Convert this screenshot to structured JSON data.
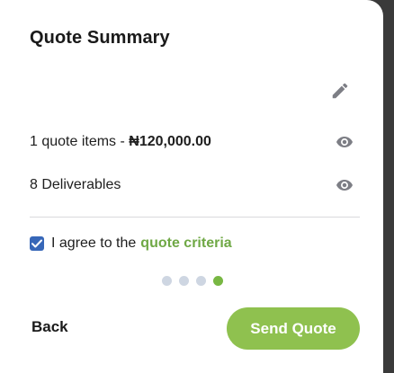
{
  "dialog": {
    "title": "Quote Summary"
  },
  "summary": {
    "items_prefix": "1 quote items - ",
    "items_amount": "₦120,000.00",
    "deliverables": "8 Deliverables"
  },
  "agreement": {
    "checked": true,
    "text": "I agree to the",
    "link_text": "quote criteria"
  },
  "pagination": {
    "total_steps": 4,
    "active_step": 4
  },
  "actions": {
    "back_label": "Back",
    "send_label": "Send Quote"
  },
  "icons": {
    "edit": "pencil-icon",
    "view": "eye-icon",
    "check": "check-icon"
  },
  "colors": {
    "accent_green": "#8fc14f",
    "link_green": "#6fa845",
    "checkbox_blue": "#3767b8",
    "icon_gray": "#7d7e85",
    "dot_inactive": "#ced6e2",
    "dot_active": "#78b743"
  }
}
